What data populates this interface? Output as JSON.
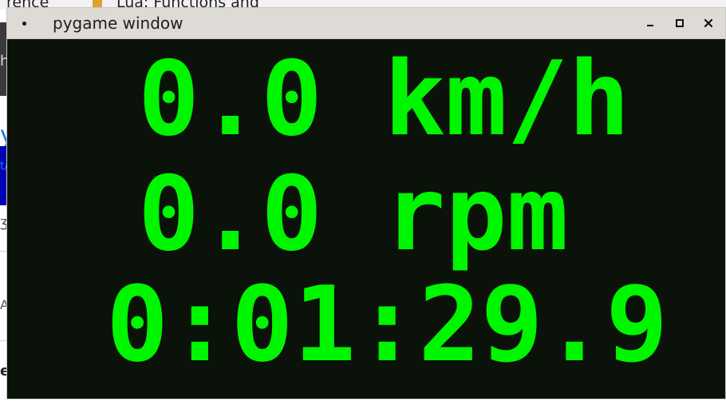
{
  "background": {
    "tab_left_text": "rence",
    "tab_right_text": "Lua: Functions and",
    "left_fragments": [
      "h",
      "y",
      "t/",
      "ʒ",
      "A",
      "e"
    ]
  },
  "window": {
    "title": "pygame window",
    "controls": {
      "minimize": "minimize-icon",
      "maximize": "maximize-icon",
      "close": "close-icon"
    }
  },
  "display": {
    "speed": "0.0 km/h",
    "rpm": "0.0 rpm",
    "elapsed": "0:01:29.9",
    "text_color": "#00f500",
    "background_color": "#0a1209"
  }
}
